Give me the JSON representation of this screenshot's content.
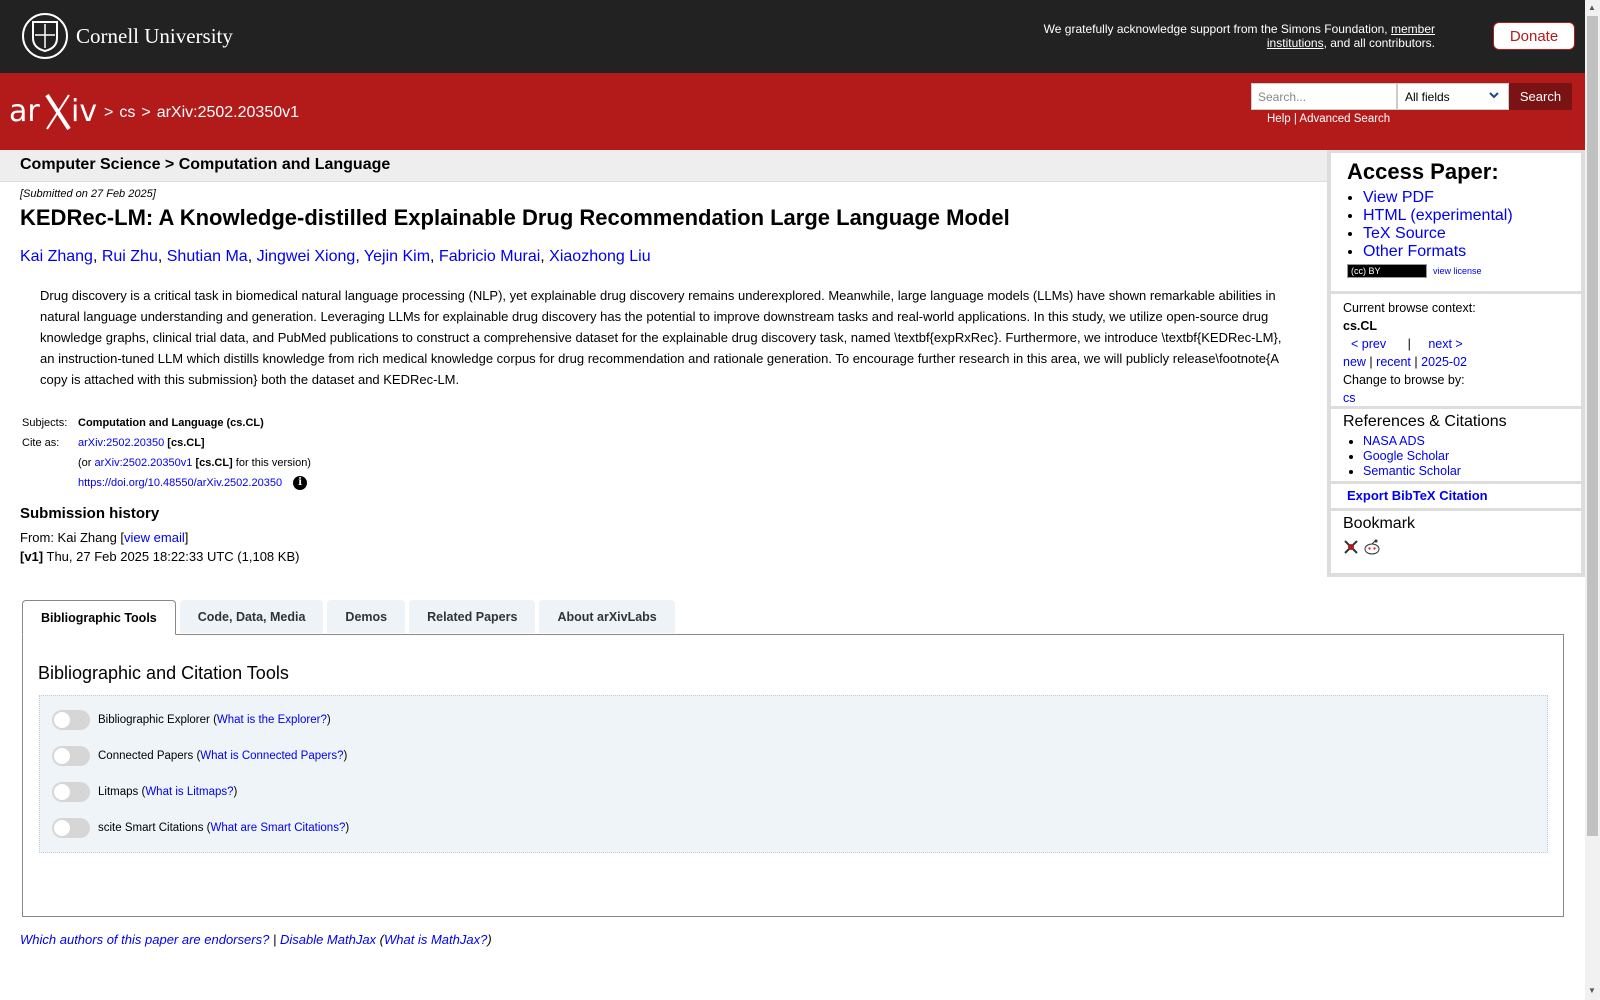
{
  "topbar": {
    "institution": "Cornell University",
    "support_text": "We gratefully acknowledge support from the Simons Foundation,",
    "support_link": "member institutions",
    "support_suffix": ", and all contributors.",
    "donate": "Donate"
  },
  "header": {
    "breadcrumb": [
      ">",
      "cs",
      ">",
      "arXiv:2502.20350v1"
    ],
    "search_placeholder": "Search...",
    "search_field": "All fields",
    "search_button": "Search",
    "help": "Help",
    "separator": "|",
    "advanced": "Advanced Search"
  },
  "paper": {
    "subject_heading": "Computer Science > Computation and Language",
    "submitted": "[Submitted on 27 Feb 2025]",
    "title": "KEDRec-LM: A Knowledge-distilled Explainable Drug Recommendation Large Language Model",
    "authors": [
      "Kai Zhang",
      "Rui Zhu",
      "Shutian Ma",
      "Jingwei Xiong",
      "Yejin Kim",
      "Fabricio Murai",
      "Xiaozhong Liu"
    ],
    "abstract": "Drug discovery is a critical task in biomedical natural language processing (NLP), yet explainable drug discovery remains underexplored. Meanwhile, large language models (LLMs) have shown remarkable abilities in natural language understanding and generation. Leveraging LLMs for explainable drug discovery has the potential to improve downstream tasks and real-world applications. In this study, we utilize open-source drug knowledge graphs, clinical trial data, and PubMed publications to construct a comprehensive dataset for the explainable drug discovery task, named \\textbf{expRxRec}. Furthermore, we introduce \\textbf{KEDRec-LM}, an instruction-tuned LLM which distills knowledge from rich medical knowledge corpus for drug recommendation and rationale generation. To encourage further research in this area, we will publicly release\\footnote{A copy is attached with this submission} both the dataset and KEDRec-LM.",
    "subjects_label": "Subjects:",
    "subjects": "Computation and Language (cs.CL)",
    "cite_label": "Cite as:",
    "cite_id": "arXiv:2502.20350",
    "cite_cat": "[cs.CL]",
    "cite_or": "(or",
    "cite_version": "arXiv:2502.20350v1",
    "cite_version_cat": "[cs.CL]",
    "cite_version_suffix": "for this version)",
    "doi": "https://doi.org/10.48550/arXiv.2502.20350",
    "history_title": "Submission history",
    "from_label": "From: Kai Zhang [",
    "view_email": "view email",
    "from_close": "]",
    "version_tag": "[v1]",
    "version_info": "Thu, 27 Feb 2025 18:22:33 UTC (1,108 KB)"
  },
  "sidebar": {
    "access_title": "Access Paper:",
    "access_links": [
      "View PDF",
      "HTML (experimental)",
      "TeX Source",
      "Other Formats"
    ],
    "license_badge": "(cc) BY",
    "view_license": "view license",
    "context_label": "Current browse context:",
    "context_value": "cs.CL",
    "prev": "< prev",
    "next": "next >",
    "nav_sep": "|",
    "new": "new",
    "recent": "recent",
    "month": "2025-02",
    "change_label": "Change to browse by:",
    "change_value": "cs",
    "refs_title": "References & Citations",
    "refs": [
      "NASA ADS",
      "Google Scholar",
      "Semantic Scholar"
    ],
    "export": "Export BibTeX Citation",
    "bookmark_title": "Bookmark"
  },
  "tabs": [
    "Bibliographic Tools",
    "Code, Data, Media",
    "Demos",
    "Related Papers",
    "About arXivLabs"
  ],
  "tools": {
    "title": "Bibliographic and Citation Tools",
    "items": [
      {
        "label": "Bibliographic Explorer",
        "link": "What is the Explorer?"
      },
      {
        "label": "Connected Papers",
        "link": "What is Connected Papers?"
      },
      {
        "label": "Litmaps",
        "link": "What is Litmaps?"
      },
      {
        "label": "scite Smart Citations",
        "link": "What are Smart Citations?"
      }
    ]
  },
  "footer": {
    "endorsers": "Which authors of this paper are endorsers?",
    "sep": "|",
    "disable_mathjax": "Disable MathJax",
    "what_mathjax": "What is MathJax?"
  },
  "colors": {
    "brand_red": "#b31b1b",
    "topbar": "#222222",
    "link": "#0000ee"
  }
}
